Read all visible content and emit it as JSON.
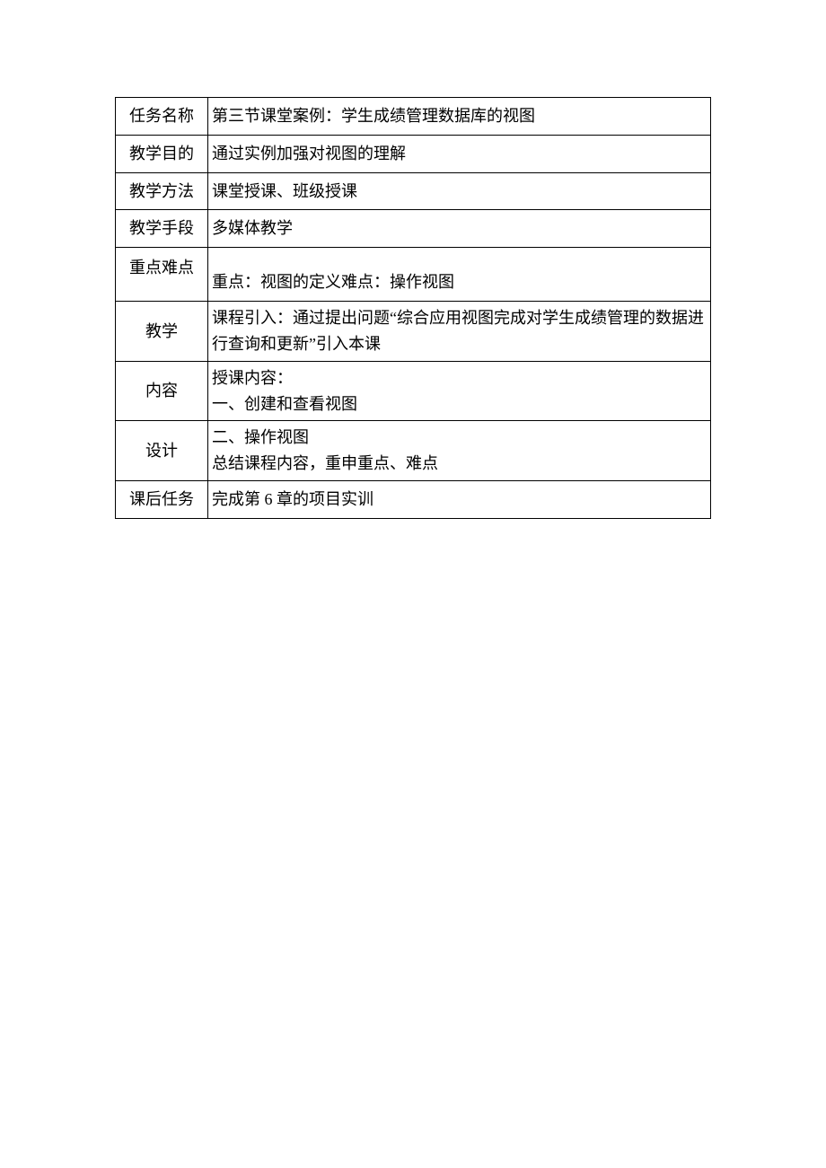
{
  "rows": {
    "task_name": {
      "label": "任务名称",
      "value": "第三节课堂案例：学生成绩管理数据库的视图"
    },
    "teach_obj": {
      "label": "教学目的",
      "value": "通过实例加强对视图的理解"
    },
    "teach_method": {
      "label": "教学方法",
      "value": "课堂授课、班级授课"
    },
    "teach_means": {
      "label": "教学手段",
      "value": "多媒体教学"
    },
    "key_diff": {
      "label": "重点难点",
      "value": "重点：视图的定义难点：操作视图"
    },
    "teach_design": {
      "label1": "教学",
      "label2": "内容",
      "label3": "设计",
      "line1": "课程引入：通过提出问题“综合应用视图完成对学生成绩管理的数据进行查询和更新”引入本课",
      "line2a": "授课内容：",
      "line2b": "一、创建和查看视图",
      "line3a": "二、操作视图",
      "line3b": "总结课程内容，重申重点、难点"
    },
    "homework": {
      "label": "课后任务",
      "value": "完成第 6 章的项目实训"
    }
  }
}
